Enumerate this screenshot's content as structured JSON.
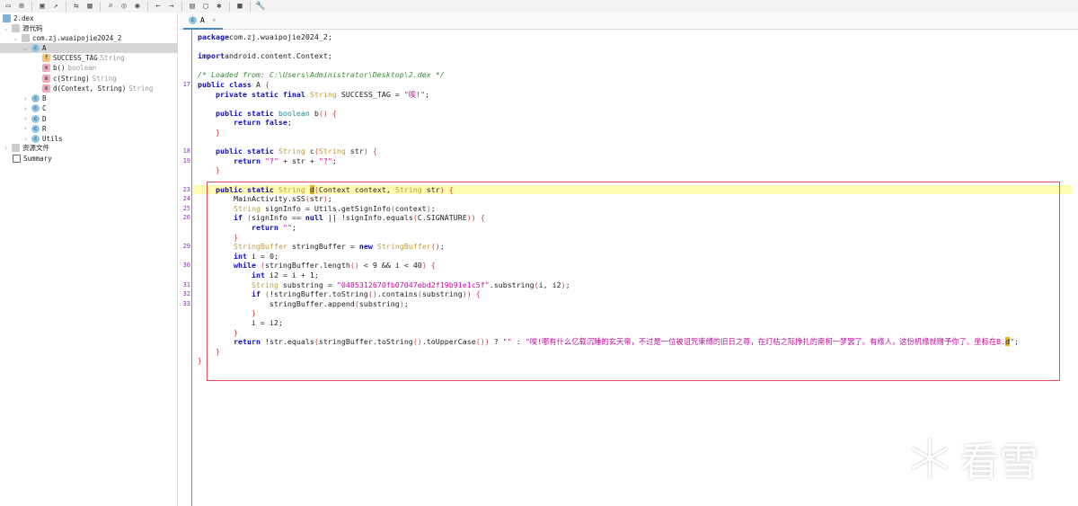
{
  "toolbar": {
    "icons": [
      "open-folder-icon",
      "add-files-icon",
      "save-icon",
      "export-icon",
      "sync-icon",
      "flatten-packages-icon",
      "search-icon",
      "search-class-icon",
      "search-usage-icon",
      "back-icon",
      "forward-icon",
      "decompile-icon",
      "log-icon",
      "debug-icon",
      "settings-panel-icon",
      "preferences-icon"
    ]
  },
  "tree": {
    "root": "2.dex",
    "source": "源代码",
    "package": "com.zj.wuaipojie2024_2",
    "class_a": "A",
    "members": [
      {
        "icon": "f",
        "name": "SUCCESS_TAG",
        "type": "String"
      },
      {
        "icon": "m",
        "name": "b()",
        "type": "boolean"
      },
      {
        "icon": "m",
        "name": "c(String)",
        "type": "String"
      },
      {
        "icon": "m",
        "name": "d(Context, String)",
        "type": "String"
      }
    ],
    "classes": [
      "B",
      "C",
      "D",
      "R",
      "Utils"
    ],
    "resources": "资源文件",
    "summary": "Summary"
  },
  "tab": {
    "label": "A",
    "close": "×"
  },
  "code": [
    {
      "n": "",
      "t": [
        [
          "kw",
          "package"
        ],
        [
          "",
          "com.zj.wuaipojie2024_2;"
        ]
      ]
    },
    {
      "n": "",
      "t": []
    },
    {
      "n": "",
      "t": [
        [
          "kw",
          "import"
        ],
        [
          "",
          "android.content.Context;"
        ]
      ]
    },
    {
      "n": "",
      "t": []
    },
    {
      "n": "",
      "t": [
        [
          "cm",
          "/* Loaded from: C:\\Users\\Administrator\\Desktop\\2.dex */"
        ]
      ]
    },
    {
      "n": "17",
      "t": [
        [
          "kw",
          "public class"
        ],
        [
          "",
          " A "
        ],
        [
          "br",
          "{"
        ]
      ]
    },
    {
      "n": "",
      "t": [
        [
          "",
          "    "
        ],
        [
          "kw",
          "private static final"
        ],
        [
          "",
          " "
        ],
        [
          "ty",
          "String"
        ],
        [
          "",
          " SUCCESS_TAG = "
        ],
        [
          "st",
          "\"唉!\""
        ],
        [
          "",
          ";"
        ]
      ]
    },
    {
      "n": "",
      "t": []
    },
    {
      "n": "",
      "t": [
        [
          "",
          "    "
        ],
        [
          "kw",
          "public static"
        ],
        [
          "",
          " "
        ],
        [
          "bt",
          "boolean"
        ],
        [
          "",
          " b"
        ],
        [
          "br",
          "() {"
        ]
      ]
    },
    {
      "n": "",
      "t": [
        [
          "",
          "        "
        ],
        [
          "kw",
          "return false"
        ],
        [
          "",
          ";"
        ]
      ]
    },
    {
      "n": "",
      "t": [
        [
          "",
          "    "
        ],
        [
          "br",
          "}"
        ]
      ]
    },
    {
      "n": "",
      "t": []
    },
    {
      "n": "18",
      "t": [
        [
          "",
          "    "
        ],
        [
          "kw",
          "public static"
        ],
        [
          "",
          " "
        ],
        [
          "ty",
          "String"
        ],
        [
          "",
          " c"
        ],
        [
          "br",
          "("
        ],
        [
          "ty",
          "String"
        ],
        [
          "",
          " str"
        ],
        [
          "br",
          ") {"
        ]
      ]
    },
    {
      "n": "19",
      "t": [
        [
          "",
          "        "
        ],
        [
          "kw",
          "return"
        ],
        [
          "",
          " "
        ],
        [
          "st",
          "\"?\""
        ],
        [
          "",
          " + str + "
        ],
        [
          "st",
          "\"?\""
        ],
        [
          "",
          ";"
        ]
      ]
    },
    {
      "n": "",
      "t": [
        [
          "",
          "    "
        ],
        [
          "br",
          "}"
        ]
      ]
    },
    {
      "n": "",
      "t": []
    },
    {
      "n": "23",
      "hl": true,
      "t": [
        [
          "",
          "    "
        ],
        [
          "kw",
          "public static"
        ],
        [
          "",
          " "
        ],
        [
          "ty",
          "String"
        ],
        [
          "",
          " "
        ],
        [
          "mark",
          "d"
        ],
        [
          "br",
          "("
        ],
        [
          "",
          "Context context, "
        ],
        [
          "ty",
          "String"
        ],
        [
          "",
          " str"
        ],
        [
          "br",
          ") {"
        ]
      ]
    },
    {
      "n": "24",
      "t": [
        [
          "",
          "        MainActivity.sSS"
        ],
        [
          "br",
          "("
        ],
        [
          "",
          "str"
        ],
        [
          "br",
          ")"
        ],
        [
          "",
          ";"
        ]
      ]
    },
    {
      "n": "25",
      "t": [
        [
          "",
          "        "
        ],
        [
          "ty",
          "String"
        ],
        [
          "",
          " signInfo = Utils.getSignInfo"
        ],
        [
          "br",
          "("
        ],
        [
          "",
          "context"
        ],
        [
          "br",
          ")"
        ],
        [
          "",
          ";"
        ]
      ]
    },
    {
      "n": "26",
      "t": [
        [
          "",
          "        "
        ],
        [
          "kw",
          "if"
        ],
        [
          "",
          " "
        ],
        [
          "br",
          "("
        ],
        [
          "",
          "signInfo == "
        ],
        [
          "kw",
          "null"
        ],
        [
          "",
          " || !signInfo.equals"
        ],
        [
          "br",
          "("
        ],
        [
          "",
          "C.SIGNATURE"
        ],
        [
          "br",
          ")) {"
        ]
      ]
    },
    {
      "n": "",
      "t": [
        [
          "",
          "            "
        ],
        [
          "kw",
          "return"
        ],
        [
          "",
          " "
        ],
        [
          "st",
          "\"\""
        ],
        [
          "",
          ";"
        ]
      ]
    },
    {
      "n": "",
      "t": [
        [
          "",
          "        "
        ],
        [
          "br",
          "}"
        ]
      ]
    },
    {
      "n": "29",
      "t": [
        [
          "",
          "        "
        ],
        [
          "ty",
          "StringBuffer"
        ],
        [
          "",
          " stringBuffer = "
        ],
        [
          "kw",
          "new"
        ],
        [
          "",
          " "
        ],
        [
          "ty",
          "StringBuffer"
        ],
        [
          "br",
          "()"
        ],
        [
          "",
          ";"
        ]
      ]
    },
    {
      "n": "",
      "t": [
        [
          "",
          "        "
        ],
        [
          "kw",
          "int"
        ],
        [
          "",
          " i = 0;"
        ]
      ]
    },
    {
      "n": "30",
      "t": [
        [
          "",
          "        "
        ],
        [
          "kw",
          "while"
        ],
        [
          "",
          " "
        ],
        [
          "br",
          "("
        ],
        [
          "",
          "stringBuffer.length"
        ],
        [
          "br",
          "()"
        ],
        [
          "",
          " < 9 && i < 40"
        ],
        [
          "br",
          ") {"
        ]
      ]
    },
    {
      "n": "",
      "t": [
        [
          "",
          "            "
        ],
        [
          "kw",
          "int"
        ],
        [
          "",
          " i2 = i + 1;"
        ]
      ]
    },
    {
      "n": "31",
      "t": [
        [
          "",
          "            "
        ],
        [
          "ty",
          "String"
        ],
        [
          "",
          " substring = "
        ],
        [
          "st",
          "\"0485312670fb07047ebd2f19b91e1c5f\""
        ],
        [
          "",
          ".substring"
        ],
        [
          "br",
          "("
        ],
        [
          "",
          "i, i2"
        ],
        [
          "br",
          ")"
        ],
        [
          "",
          ";"
        ]
      ]
    },
    {
      "n": "32",
      "t": [
        [
          "",
          "            "
        ],
        [
          "kw",
          "if"
        ],
        [
          "",
          " "
        ],
        [
          "br",
          "("
        ],
        [
          "",
          "!stringBuffer.toString"
        ],
        [
          "br",
          "()"
        ],
        [
          "",
          ".contains"
        ],
        [
          "br",
          "("
        ],
        [
          "",
          "substring"
        ],
        [
          "br",
          ")) {"
        ]
      ]
    },
    {
      "n": "33",
      "t": [
        [
          "",
          "                stringBuffer.append"
        ],
        [
          "br",
          "("
        ],
        [
          "",
          "substring"
        ],
        [
          "br",
          ")"
        ],
        [
          "",
          ";"
        ]
      ]
    },
    {
      "n": "",
      "t": [
        [
          "",
          "            "
        ],
        [
          "br",
          "}"
        ]
      ]
    },
    {
      "n": "",
      "t": [
        [
          "",
          "            i = i2;"
        ]
      ]
    },
    {
      "n": "",
      "t": [
        [
          "",
          "        "
        ],
        [
          "br",
          "}"
        ]
      ]
    },
    {
      "n": "",
      "t": [
        [
          "",
          "        "
        ],
        [
          "kw",
          "return"
        ],
        [
          "",
          " !str.equals"
        ],
        [
          "br",
          "("
        ],
        [
          "",
          "stringBuffer.toString"
        ],
        [
          "br",
          "()"
        ],
        [
          "",
          ".toUpperCase"
        ],
        [
          "br",
          "())"
        ],
        [
          "",
          " ? "
        ],
        [
          "st",
          "\"\""
        ],
        [
          "",
          " : "
        ],
        [
          "st",
          "\"唉!哪有什么亿载沉睡的玄天帝，不过是一位被诅咒束缚的旧日之尊，在灯枯之际挣扎的南柯一梦罢了。有缘人，这份机缘就赠予你了。坐标在B."
        ],
        [
          "mark",
          "d"
        ],
        [
          "st",
          "\""
        ],
        [
          "",
          ";"
        ]
      ]
    },
    {
      "n": "",
      "t": [
        [
          "",
          "    "
        ],
        [
          "br",
          "}"
        ]
      ]
    },
    {
      "n": "",
      "t": [
        [
          "br",
          "}"
        ]
      ]
    }
  ],
  "watermark": "看雪"
}
